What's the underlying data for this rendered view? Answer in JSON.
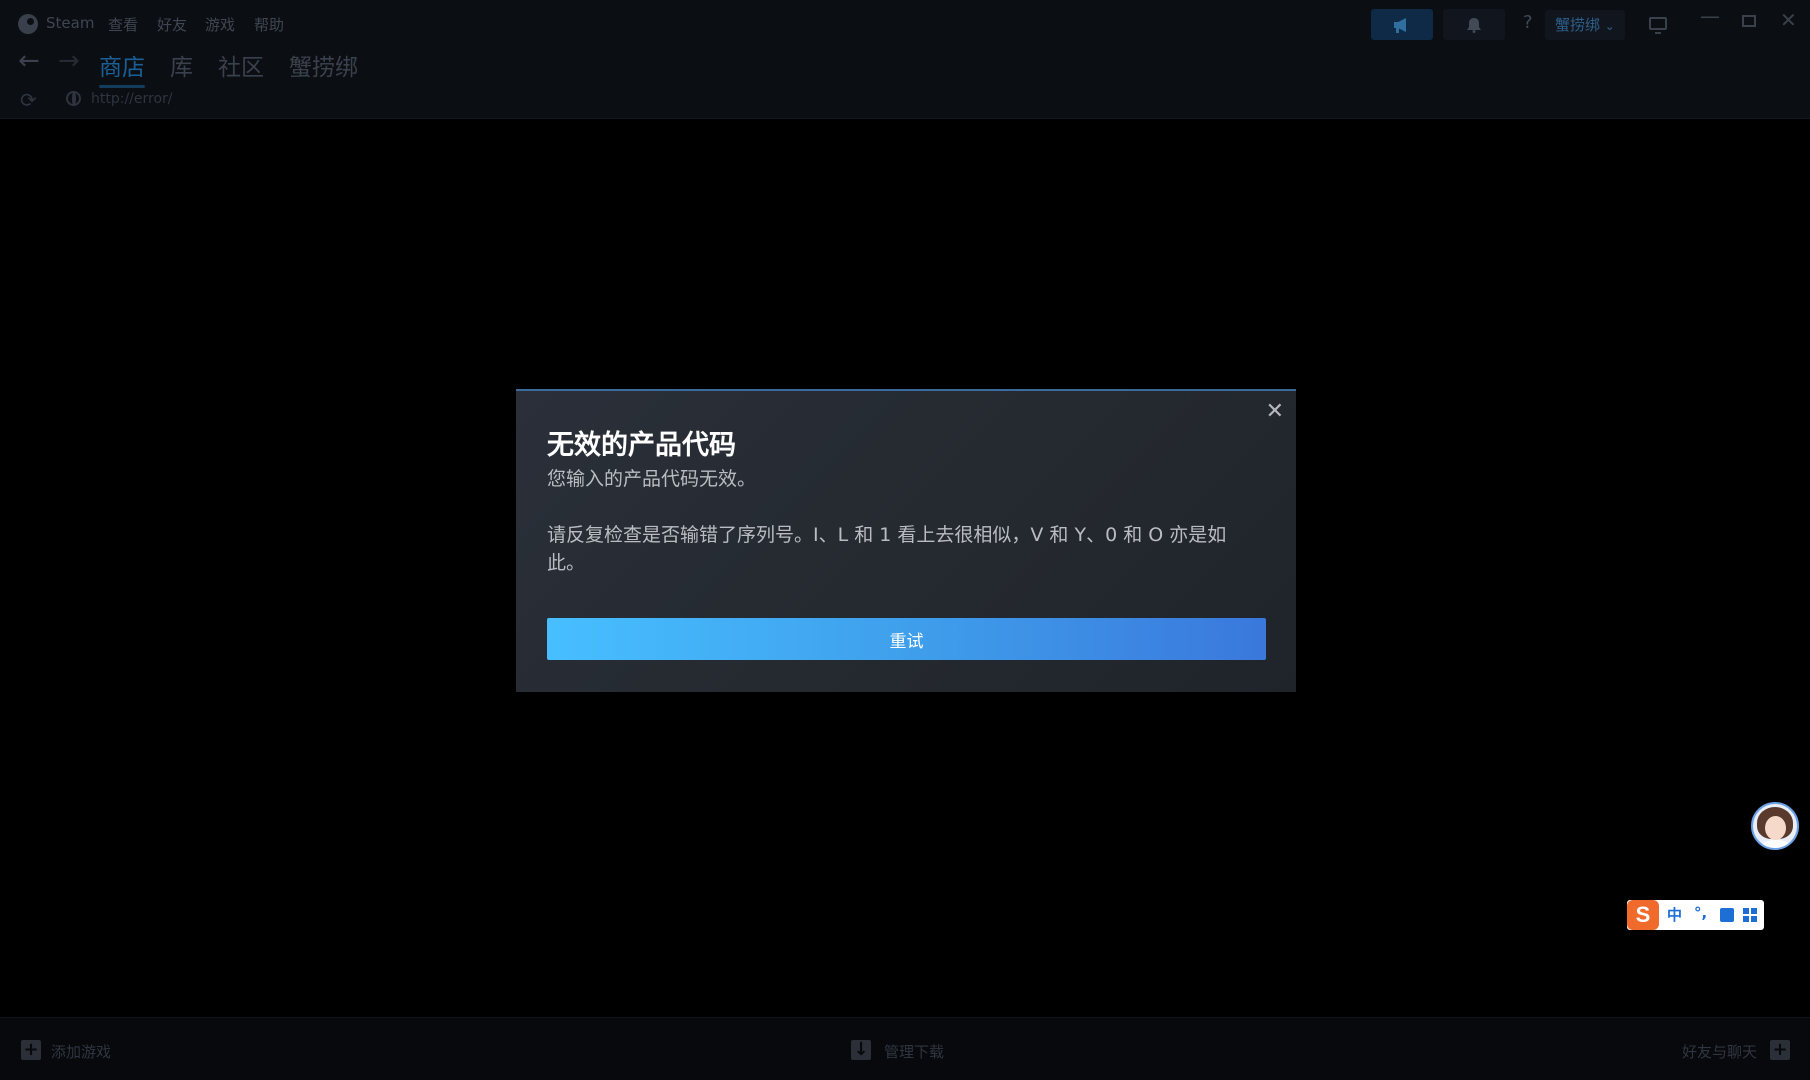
{
  "titlebar": {
    "app_name": "Steam",
    "menu": [
      "查看",
      "好友",
      "游戏",
      "帮助"
    ],
    "account_name": "蟹捞绑",
    "account_chevron": "⌄",
    "help_label": "?",
    "announce_icon": "megaphone-icon",
    "bell_icon": "bell-icon"
  },
  "nav": {
    "back": "←",
    "forward": "→",
    "tabs": [
      {
        "label": "商店",
        "active": true
      },
      {
        "label": "库",
        "active": false
      },
      {
        "label": "社区",
        "active": false
      },
      {
        "label": "蟹捞绑",
        "active": false
      }
    ]
  },
  "urlbar": {
    "reload": "⟳",
    "url": "http://error/"
  },
  "dialog": {
    "close": "✕",
    "title": "无效的产品代码",
    "subtitle": "您输入的产品代码无效。",
    "body": "请反复检查是否输错了序列号。I、L 和 1 看上去很相似，V 和 Y、0 和 O 亦是如此。",
    "retry_label": "重试"
  },
  "bottombar": {
    "add_game": "添加游戏",
    "add_game_icon": "+",
    "manage_downloads": "管理下载",
    "downloads_icon": "↓",
    "friends_chat": "好友与聊天",
    "friends_icon": "+"
  },
  "ime": {
    "logo": "S",
    "mode": "中",
    "punct": "°,"
  },
  "colors": {
    "accent": "#47bfff",
    "accent_end": "#3a78dc",
    "dialog_bg": "#272c34"
  }
}
